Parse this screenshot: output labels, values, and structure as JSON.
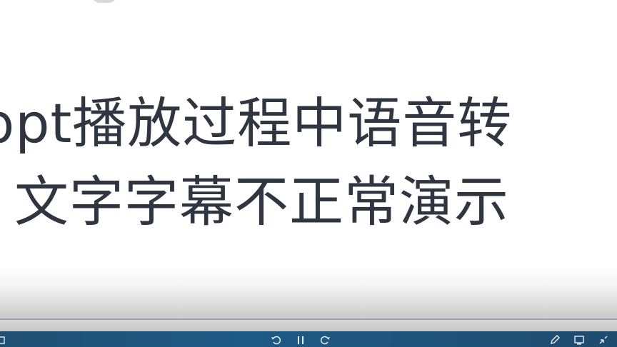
{
  "slide": {
    "title_line1": "ppt播放过程中语音转",
    "title_line2": "文字字幕不正常演示"
  },
  "taskbar": {
    "icons": [
      "undo-icon",
      "pause-icon",
      "redo-icon",
      "pen-icon",
      "display-icon",
      "exit-fullscreen-icon"
    ]
  },
  "colors": {
    "title_text": "#2f3640",
    "taskbar": "#1d5a86"
  }
}
